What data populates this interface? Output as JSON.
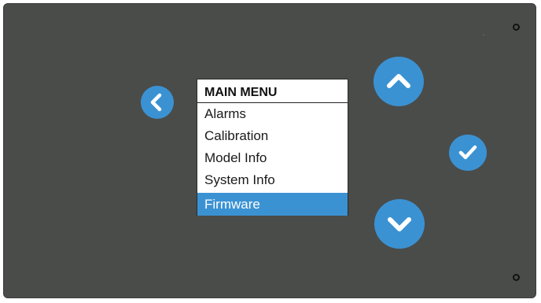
{
  "menu": {
    "title": "MAIN MENU",
    "items": [
      {
        "label": "Alarms",
        "selected": false
      },
      {
        "label": "Calibration",
        "selected": false
      },
      {
        "label": "Model Info",
        "selected": false
      },
      {
        "label": "System Info",
        "selected": false
      },
      {
        "label": "Firmware",
        "selected": true
      }
    ]
  },
  "buttons": {
    "back": {
      "icon": "chevron-left-icon"
    },
    "up": {
      "icon": "chevron-up-icon"
    },
    "ok": {
      "icon": "checkmark-icon"
    },
    "down": {
      "icon": "chevron-down-icon"
    }
  },
  "colors": {
    "panel": "#4a4c4a",
    "accent": "#3b92d3",
    "selected_text": "#ffffff"
  }
}
